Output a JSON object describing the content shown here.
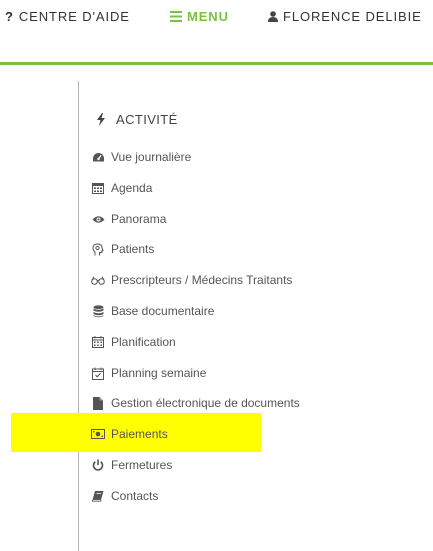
{
  "header": {
    "help_label": "CENTRE D'AIDE",
    "menu_label": "MENU",
    "user_label": "FLORENCE DELIBIE",
    "accent_color": "#7ac143"
  },
  "sidebar": {
    "section_title": "ACTIVITÉ",
    "highlight_color": "#ffff00",
    "items": [
      {
        "label": "Vue journalière",
        "icon": "dashboard-icon"
      },
      {
        "label": "Agenda",
        "icon": "calendar-icon"
      },
      {
        "label": "Panorama",
        "icon": "eye-icon"
      },
      {
        "label": "Patients",
        "icon": "head-icon"
      },
      {
        "label": "Prescripteurs / Médecins Traitants",
        "icon": "glasses-icon"
      },
      {
        "label": "Base documentaire",
        "icon": "database-icon"
      },
      {
        "label": "Planification",
        "icon": "calendar-grid-icon"
      },
      {
        "label": "Planning semaine",
        "icon": "calendar-check-icon"
      },
      {
        "label": "Gestion électronique de documents",
        "icon": "file-icon"
      },
      {
        "label": "Paiements",
        "icon": "money-icon",
        "highlighted": true
      },
      {
        "label": "Fermetures",
        "icon": "power-icon"
      },
      {
        "label": "Contacts",
        "icon": "book-icon"
      }
    ]
  }
}
